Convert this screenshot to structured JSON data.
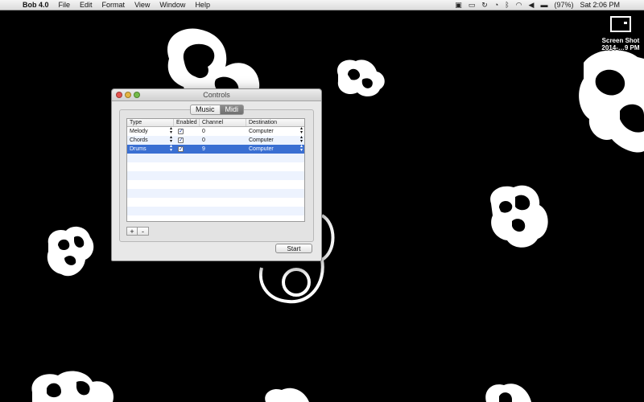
{
  "menubar": {
    "app_name": "Bob 4.0",
    "menus": [
      "File",
      "Edit",
      "Format",
      "View",
      "Window",
      "Help"
    ],
    "battery": "(97%)",
    "clock": "Sat 2:06 PM"
  },
  "desktop_icon": {
    "label_line1": "Screen Shot",
    "label_line2": "2014-…9 PM"
  },
  "window": {
    "title": "Controls",
    "tabs": [
      "Music",
      "Midi"
    ],
    "selected_tab": "Midi",
    "table": {
      "columns": [
        "Type",
        "Enabled",
        "Channel",
        "Destination"
      ],
      "rows": [
        {
          "type": "Melody",
          "enabled": true,
          "channel": "0",
          "destination": "Computer"
        },
        {
          "type": "Chords",
          "enabled": true,
          "channel": "0",
          "destination": "Computer"
        },
        {
          "type": "Drums",
          "enabled": true,
          "channel": "9",
          "destination": "Computer"
        }
      ]
    },
    "add_label": "+",
    "remove_label": "-",
    "start_label": "Start"
  }
}
